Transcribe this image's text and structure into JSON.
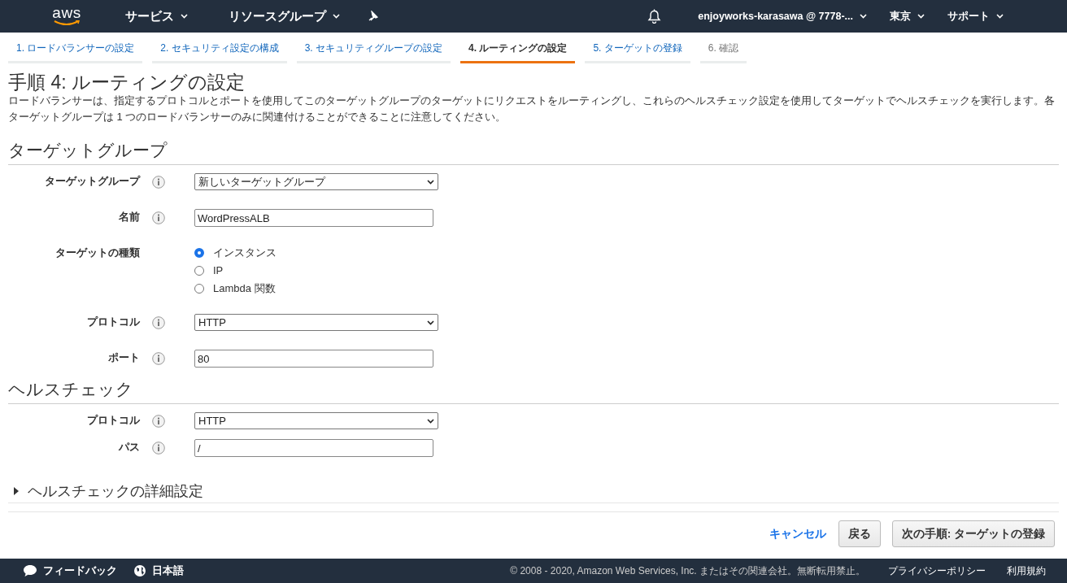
{
  "nav": {
    "logo": "aws",
    "menus": [
      {
        "label": "サービス"
      },
      {
        "label": "リソースグループ"
      }
    ],
    "account": "enjoyworks-karasawa @ 7778-...",
    "right_menus": [
      {
        "label": "東京"
      },
      {
        "label": "サポート"
      }
    ]
  },
  "steps": [
    {
      "label": "1. ロードバランサーの設定",
      "selected": false,
      "disabled": false
    },
    {
      "label": "2. セキュリティ設定の構成",
      "selected": false,
      "disabled": false
    },
    {
      "label": "3. セキュリティグループの設定",
      "selected": false,
      "disabled": false
    },
    {
      "label": "4. ルーティングの設定",
      "selected": true,
      "disabled": false
    },
    {
      "label": "5. ターゲットの登録",
      "selected": false,
      "disabled": false
    },
    {
      "label": "6. 確認",
      "selected": false,
      "disabled": true
    }
  ],
  "title": "手順 4: ルーティングの設定",
  "description": "ロードバランサーは、指定するプロトコルとポートを使用してこのターゲットグループのターゲットにリクエストをルーティングし、これらのヘルスチェック設定を使用してターゲットでヘルスチェックを実行します。各ターゲットグループは 1 つのロードバランサーのみに関連付けることができることに注意してください。",
  "sections": [
    {
      "heading": "ターゲットグループ",
      "fields": [
        {
          "kind": "select",
          "label": "ターゲットグループ",
          "info": true,
          "value": "新しいターゲットグループ"
        },
        {
          "kind": "text",
          "label": "名前",
          "info": true,
          "value": "WordPressALB"
        },
        {
          "kind": "radio",
          "label": "ターゲットの種類",
          "info": false,
          "options": [
            {
              "label": "インスタンス",
              "selected": true
            },
            {
              "label": "IP",
              "selected": false
            },
            {
              "label": "Lambda 関数",
              "selected": false
            }
          ]
        },
        {
          "kind": "select",
          "label": "プロトコル",
          "info": true,
          "value": "HTTP"
        },
        {
          "kind": "text",
          "label": "ポート",
          "info": true,
          "value": "80"
        }
      ]
    },
    {
      "heading": "ヘルスチェック",
      "fields": [
        {
          "kind": "select",
          "label": "プロトコル",
          "info": true,
          "value": "HTTP"
        },
        {
          "kind": "text",
          "label": "パス",
          "info": true,
          "value": "/"
        }
      ]
    }
  ],
  "advanced": {
    "label": "ヘルスチェックの詳細設定",
    "expanded": false
  },
  "actions": {
    "cancel": "キャンセル",
    "back": "戻る",
    "next": "次の手順: ターゲットの登録"
  },
  "footer": {
    "feedback": "フィードバック",
    "language": "日本語",
    "copyright": "© 2008 - 2020, Amazon Web Services, Inc. またはその関連会社。無断転用禁止。",
    "links": [
      "プライバシーポリシー",
      "利用規約"
    ]
  }
}
